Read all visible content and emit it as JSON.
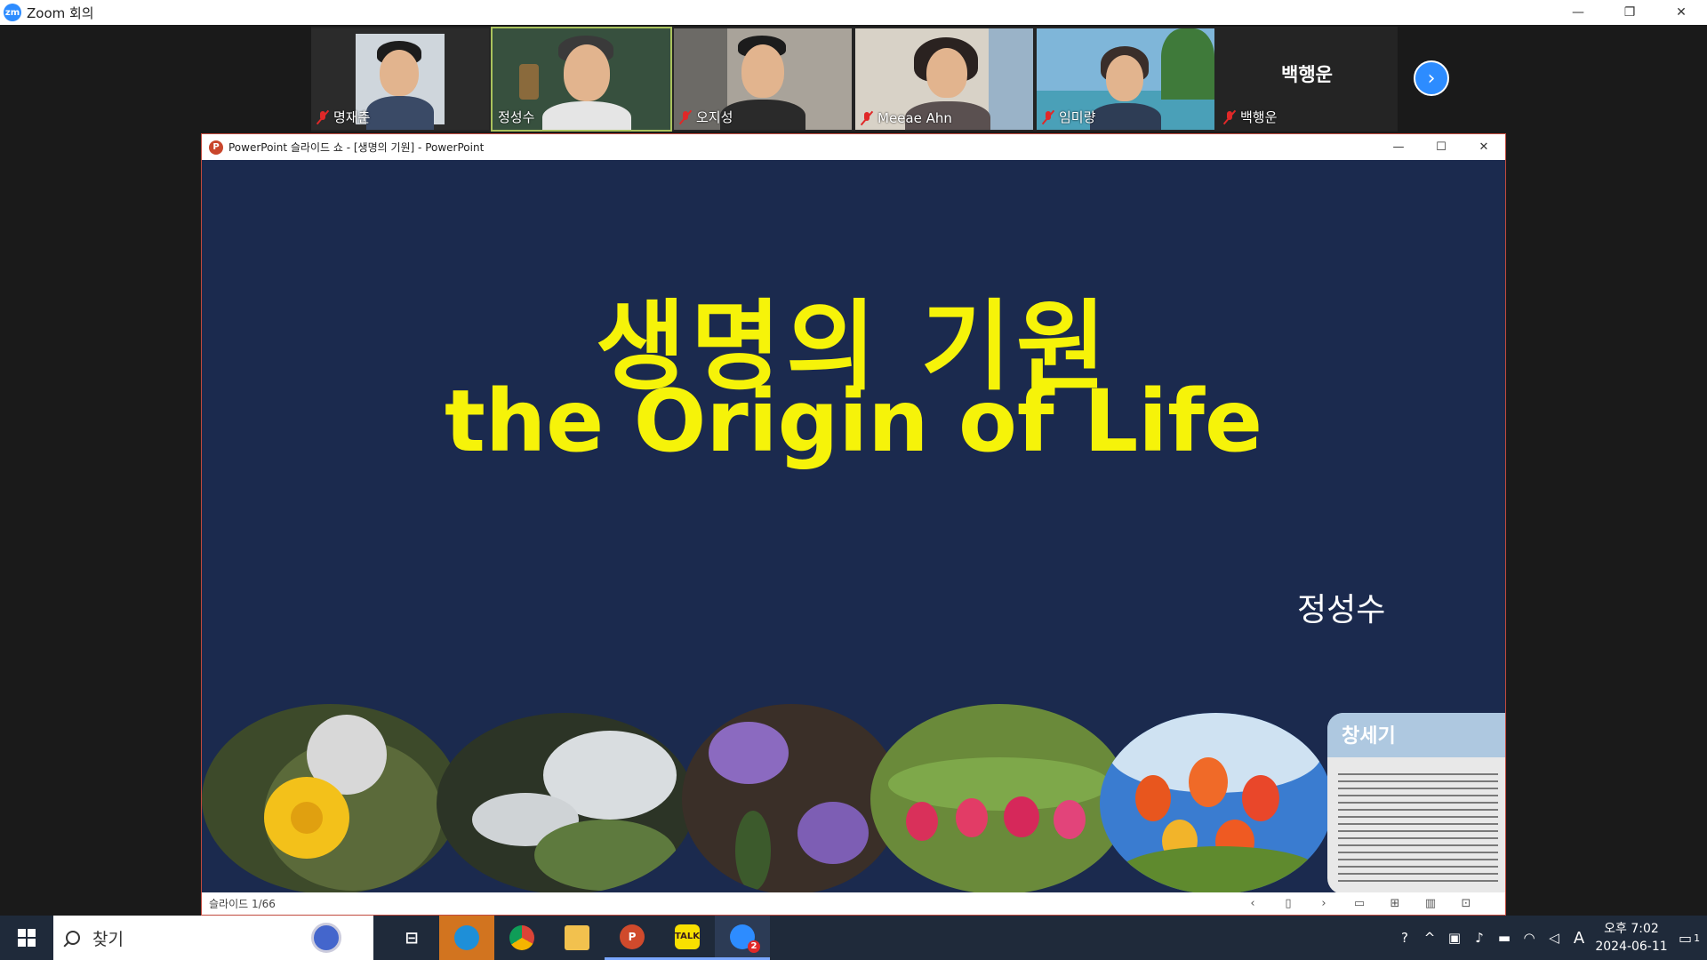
{
  "zoom": {
    "logo": "zm",
    "window_title": "Zoom 회의",
    "controls": {
      "minimize": "—",
      "restore": "❐",
      "close": "✕"
    }
  },
  "gallery": {
    "participants": [
      {
        "name": "명재춘",
        "muted": true
      },
      {
        "name": "정성수",
        "muted": false
      },
      {
        "name": "오지성",
        "muted": true
      },
      {
        "name": "Meeae Ahn",
        "muted": true
      },
      {
        "name": "임미량",
        "muted": true
      },
      {
        "name": "백행운",
        "muted": true,
        "video_off_label": "백행운"
      }
    ],
    "next_icon": "chevron-right-icon"
  },
  "powerpoint": {
    "icon": "P",
    "window_title": "PowerPoint 슬라이드 쇼 - [생명의 기원] - PowerPoint",
    "controls": {
      "minimize": "—",
      "restore": "☐",
      "close": "✕"
    },
    "slide": {
      "title_ko": "생명의 기원",
      "title_en": "the Origin of Life",
      "author": "정성수",
      "bible_label": "창세기"
    },
    "status": {
      "slide_counter": "슬라이드 1/66"
    },
    "accent_color": "#f6f309",
    "background_color": "#1b2a4e"
  },
  "taskbar": {
    "search_placeholder": "찾기",
    "apps": [
      {
        "name": "task-view-icon",
        "active": false
      },
      {
        "name": "edge-icon",
        "active": true
      },
      {
        "name": "chrome-icon",
        "active": false
      },
      {
        "name": "file-explorer-icon",
        "active": false
      },
      {
        "name": "powerpoint-icon",
        "active": false
      },
      {
        "name": "kakaotalk-icon",
        "active": false,
        "label": "TALK"
      },
      {
        "name": "zoom-icon",
        "active": false,
        "badge": "2"
      }
    ],
    "tray": {
      "ime": "A",
      "time": "오후 7:02",
      "date": "2024-06-11",
      "notification_count": "1"
    }
  }
}
